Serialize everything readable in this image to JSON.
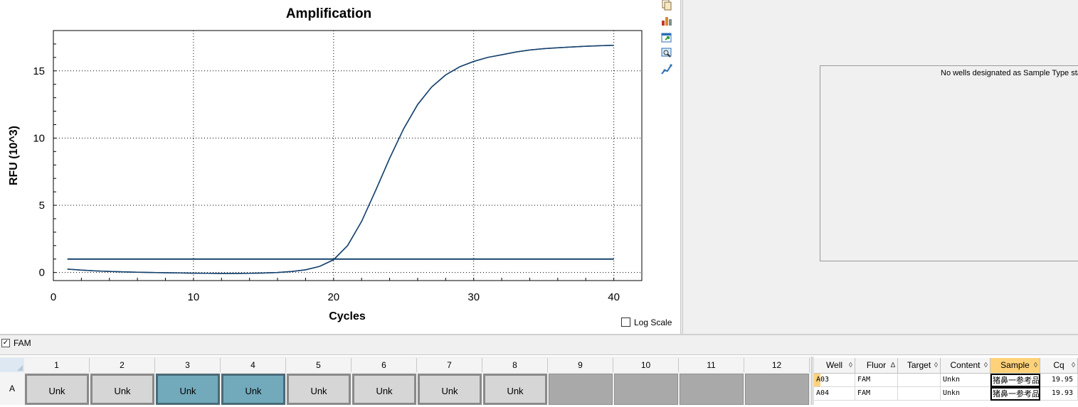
{
  "chart_data": {
    "type": "line",
    "title": "Amplification",
    "xlabel": "Cycles",
    "ylabel": "RFU (10^3)",
    "xlim": [
      0,
      42
    ],
    "ylim": [
      -0.6,
      18
    ],
    "xticks": [
      0,
      10,
      20,
      30,
      40
    ],
    "yticks": [
      0,
      5,
      10,
      15
    ],
    "grid": true,
    "series": [
      {
        "color": "#16426e",
        "x": [
          1,
          2,
          3,
          4,
          5,
          6,
          7,
          8,
          9,
          10,
          11,
          12,
          13,
          14,
          15,
          16,
          17,
          18,
          19,
          20,
          21,
          22,
          23,
          24,
          25,
          26,
          27,
          28,
          29,
          30,
          31,
          32,
          33,
          34,
          35,
          36,
          37,
          38,
          39,
          40
        ],
        "values": [
          0.25,
          0.18,
          0.12,
          0.08,
          0.05,
          0.02,
          0.0,
          -0.02,
          -0.03,
          -0.05,
          -0.06,
          -0.07,
          -0.07,
          -0.06,
          -0.04,
          0.0,
          0.07,
          0.2,
          0.45,
          0.95,
          2.0,
          3.8,
          6.1,
          8.5,
          10.7,
          12.5,
          13.8,
          14.7,
          15.3,
          15.7,
          16.0,
          16.2,
          16.4,
          16.55,
          16.65,
          16.72,
          16.78,
          16.83,
          16.87,
          16.9
        ]
      },
      {
        "color": "#16426e",
        "x": [
          1,
          2,
          3,
          4,
          5,
          6,
          7,
          8,
          9,
          10,
          11,
          12,
          13,
          14,
          15,
          16,
          17,
          18,
          19,
          20,
          21,
          22,
          23,
          24,
          25,
          26,
          27,
          28,
          29,
          30,
          31,
          32,
          33,
          34,
          35,
          36,
          37,
          38,
          39,
          40
        ],
        "values": [
          0.25,
          0.18,
          0.12,
          0.08,
          0.05,
          0.02,
          0.0,
          -0.02,
          -0.03,
          -0.05,
          -0.06,
          -0.07,
          -0.07,
          -0.06,
          -0.04,
          0.0,
          0.07,
          0.2,
          0.45,
          0.95,
          2.0,
          3.8,
          6.1,
          8.5,
          10.7,
          12.5,
          13.8,
          14.7,
          15.3,
          15.7,
          16.0,
          16.2,
          16.4,
          16.55,
          16.65,
          16.72,
          16.78,
          16.83,
          16.87,
          16.9
        ]
      }
    ],
    "threshold": {
      "value": 1.0,
      "from": 1,
      "to": 40,
      "color": "#16426e"
    }
  },
  "toolbar": {
    "icons": [
      "copy-icon",
      "bar-chart-icon",
      "export-icon",
      "zoom-icon",
      "curve-icon"
    ]
  },
  "std_curve": {
    "message": "No wells designated as Sample Type star"
  },
  "log_scale": {
    "label": "Log Scale",
    "checked": false
  },
  "fluor": {
    "label": "FAM",
    "checked": true
  },
  "plate": {
    "columns": [
      "1",
      "2",
      "3",
      "4",
      "5",
      "6",
      "7",
      "8",
      "9",
      "10",
      "11",
      "12"
    ],
    "row_label": "A",
    "wells": [
      {
        "label": "Unk",
        "state": "unk"
      },
      {
        "label": "Unk",
        "state": "unk"
      },
      {
        "label": "Unk",
        "state": "sel"
      },
      {
        "label": "Unk",
        "state": "sel"
      },
      {
        "label": "Unk",
        "state": "unk"
      },
      {
        "label": "Unk",
        "state": "unk"
      },
      {
        "label": "Unk",
        "state": "unk"
      },
      {
        "label": "Unk",
        "state": "unk"
      },
      {
        "label": "",
        "state": "empty"
      },
      {
        "label": "",
        "state": "empty"
      },
      {
        "label": "",
        "state": "empty"
      },
      {
        "label": "",
        "state": "empty"
      }
    ],
    "colors": {
      "selected": "#72aabb",
      "unknown": "#d6d6d6",
      "empty": "#a9a9a9"
    }
  },
  "results_table": {
    "headers": [
      "Well",
      "Fluor",
      "Target",
      "Content",
      "Sample",
      "Cq"
    ],
    "sort_markers": [
      "◊",
      "∆",
      "◊",
      "◊",
      "◊",
      "◊"
    ],
    "sorted_column": "Sample",
    "rows": [
      [
        "A03",
        "FAM",
        "",
        "Unkn",
        "猪鼻一参考品",
        "19.95"
      ],
      [
        "A04",
        "FAM",
        "",
        "Unkn",
        "猪鼻一参考品",
        "19.93"
      ]
    ]
  }
}
